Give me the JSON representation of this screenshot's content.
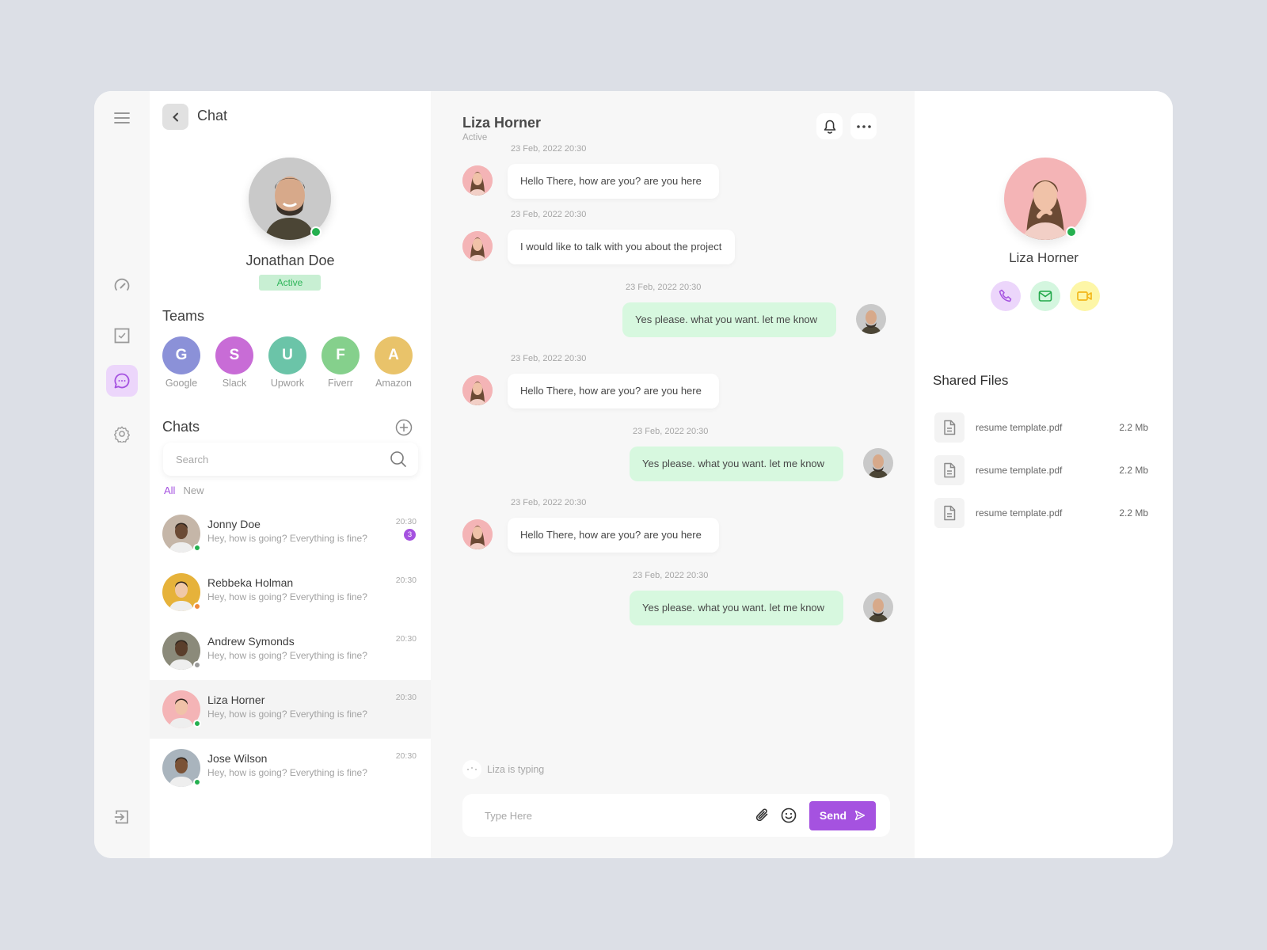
{
  "sidebar": {
    "items": [
      {
        "name": "menu",
        "icon": "hamburger-menu-icon"
      },
      {
        "name": "dashboard",
        "icon": "speedometer-icon"
      },
      {
        "name": "tasks",
        "icon": "checkbox-icon"
      },
      {
        "name": "chat",
        "icon": "chat-bubble-icon",
        "active": true
      },
      {
        "name": "settings",
        "icon": "gear-icon"
      },
      {
        "name": "logout",
        "icon": "logout-icon"
      }
    ]
  },
  "left_panel": {
    "title": "Chat",
    "profile": {
      "name": "Jonathan Doe",
      "status": "Active"
    },
    "teams_title": "Teams",
    "teams": [
      {
        "initial": "G",
        "label": "Google",
        "color": "#8b91d8"
      },
      {
        "initial": "S",
        "label": "Slack",
        "color": "#c86cd6"
      },
      {
        "initial": "U",
        "label": "Upwork",
        "color": "#6bc4a8"
      },
      {
        "initial": "F",
        "label": "Fiverr",
        "color": "#85d08c"
      },
      {
        "initial": "A",
        "label": "Amazon",
        "color": "#e9c36a"
      }
    ],
    "chats_title": "Chats",
    "search_placeholder": "Search",
    "filters": [
      "All",
      "New"
    ],
    "chats": [
      {
        "name": "Jonny Doe",
        "preview": "Hey, how is going? Everything is fine?",
        "time": "20:30",
        "unread": "3",
        "presence": "online"
      },
      {
        "name": "Rebbeka Holman",
        "preview": "Hey, how is going? Everything is fine?",
        "time": "20:30",
        "presence": "away"
      },
      {
        "name": "Andrew Symonds",
        "preview": "Hey, how is going? Everything is fine?",
        "time": "20:30",
        "presence": "offline"
      },
      {
        "name": "Liza Horner",
        "preview": "Hey, how is going? Everything is fine?",
        "time": "20:30",
        "presence": "online",
        "selected": true
      },
      {
        "name": "Jose Wilson",
        "preview": "Hey, how is going? Everything is fine?",
        "time": "20:30",
        "presence": "online"
      }
    ]
  },
  "conversation": {
    "contact_name": "Liza Horner",
    "contact_status": "Active",
    "messages": [
      {
        "direction": "in",
        "timestamp": "23 Feb, 2022 20:30",
        "text": "Hello There, how are you? are you here"
      },
      {
        "direction": "in",
        "timestamp": "23 Feb, 2022 20:30",
        "text": "I would like to talk with you about the project"
      },
      {
        "direction": "out",
        "timestamp": "23 Feb, 2022 20:30",
        "text": "Yes please. what you want. let me know"
      },
      {
        "direction": "in",
        "timestamp": "23 Feb, 2022 20:30",
        "text": "Hello There, how are you? are you here"
      },
      {
        "direction": "out",
        "timestamp": "23 Feb, 2022 20:30",
        "text": "Yes please. what you want. let me know"
      },
      {
        "direction": "in",
        "timestamp": "23 Feb, 2022 20:30",
        "text": "Hello There, how are you? are you here"
      },
      {
        "direction": "out",
        "timestamp": "23 Feb, 2022 20:30",
        "text": "Yes please. what you want. let me know"
      }
    ],
    "typing_text": "Liza is typing",
    "composer_placeholder": "Type Here",
    "send_label": "Send"
  },
  "details": {
    "name": "Liza Horner",
    "actions": [
      "phone-icon",
      "mail-icon",
      "video-icon"
    ],
    "files_title": "Shared Files",
    "files": [
      {
        "name": "resume template.pdf",
        "size": "2.2 Mb"
      },
      {
        "name": "resume template.pdf",
        "size": "2.2 Mb"
      },
      {
        "name": "resume template.pdf",
        "size": "2.2 Mb"
      }
    ]
  },
  "colors": {
    "accent": "#a552e0",
    "accent_soft": "#ecd6fb",
    "online": "#25b04f",
    "away": "#f08a3c",
    "offline": "#9a9a9a",
    "outgoing_bubble": "#d7f8df",
    "active_badge_bg": "#c8efd3"
  }
}
